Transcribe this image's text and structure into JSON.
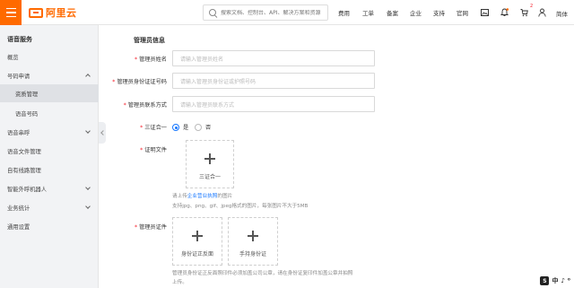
{
  "header": {
    "logo_text": "阿里云",
    "search_placeholder": "搜索文档、控制台、API、解决方案和资源",
    "nav": [
      "费用",
      "工单",
      "备案",
      "企业",
      "支持",
      "官网"
    ],
    "notification_badge": "2",
    "language": "简体"
  },
  "sidebar": {
    "title": "语音服务",
    "items": [
      {
        "label": "概览"
      },
      {
        "label": "号码申请"
      },
      {
        "label": "资质管理"
      },
      {
        "label": "语音号码"
      },
      {
        "label": "语音串呼"
      },
      {
        "label": "语音文件管理"
      },
      {
        "label": "自有线路管理"
      },
      {
        "label": "智能外呼机器人"
      },
      {
        "label": "业务统计"
      },
      {
        "label": "通用设置"
      }
    ]
  },
  "form": {
    "section_title": "管理员信息",
    "name_label": "管理员姓名",
    "name_placeholder": "请输入管理员姓名",
    "id_label": "管理员身份证证号码",
    "id_placeholder": "请输入管理员身份证或护照号码",
    "contact_label": "管理员联系方式",
    "contact_placeholder": "请输入管理员联系方式",
    "three_in_one_label": "三证合一",
    "yes": "是",
    "no": "否",
    "certificate_label": "证明文件",
    "three_in_one_upload": "三证合一",
    "cert_hint_prefix": "请上传",
    "cert_hint_link": "企业营业执照",
    "cert_hint_suffix": "的图片",
    "format_hint": "支持jpg、png、gif、jpeg格式的图片，每张图片不大于5MB",
    "admin_id_label": "管理员证件",
    "id_front_upload": "身份证正反面",
    "id_hand_upload": "手持身份证",
    "admin_id_hint_line1": "管理员身份证正反面照印件必须加盖公司公章，请在身份证复印件加盖公章并拍照",
    "admin_id_hint_line2": "上传。"
  },
  "ime": {
    "chars": [
      "中",
      "♪",
      "⁰"
    ]
  }
}
